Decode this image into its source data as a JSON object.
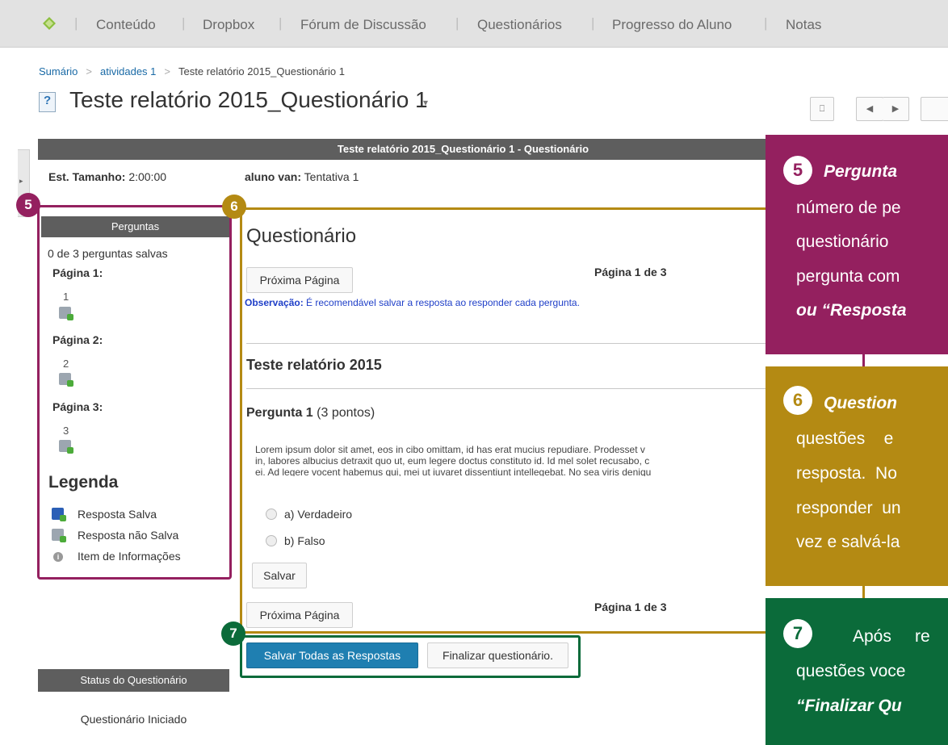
{
  "nav": {
    "logo_icon": "d2l-logo-icon",
    "items": [
      "Conteúdo",
      "Dropbox",
      "Fórum de Discussão",
      "Questionários",
      "Progresso do Aluno",
      "Notas"
    ],
    "separator": "|"
  },
  "breadcrumb": {
    "items": [
      "Sumário",
      "atividades 1"
    ],
    "current": "Teste relatório 2015_Questionário 1",
    "separator": ">"
  },
  "page": {
    "title": "Teste relatório 2015_Questionário 1",
    "title_icon": "?",
    "caret": "▾",
    "bookmark_icon": "⎕",
    "prev_icon": "◀",
    "next_icon": "▶"
  },
  "quiz": {
    "header": "Teste relatório 2015_Questionário 1 - Questionário",
    "est_label": "Est. Tamanho:",
    "est_value": "2:00:00",
    "attempt_label": "aluno van:",
    "attempt_value": "Tentativa 1",
    "title": "Questionário",
    "next_page": "Próxima Página",
    "page_of": "Página 1 de 3",
    "note_label": "Observação:",
    "note_text": "É recomendável salvar a resposta ao responder cada pergunta.",
    "section_title": "Teste relatório 2015",
    "question_label": "Pergunta 1",
    "question_points": "(3 pontos)",
    "question_lines": [
      "Lorem ipsum dolor sit amet, eos in cibo omittam, id has erat mucius repudiare. Prodesset v",
      "in, labores albucius detraxit quo ut, eum legere doctus constituto id. Id mel solet recusabo, c",
      "ei. Ad legere vocent habemus qui, mei ut iuvaret dissentiunt intellegebat. No sea viris deniqu"
    ],
    "options": [
      "a) Verdadeiro",
      "b) Falso"
    ],
    "save": "Salvar",
    "save_all": "Salvar Todas as Respostas",
    "finish": "Finalizar questionário."
  },
  "left_panel": {
    "header": "Perguntas",
    "saved_count": "0 de 3 perguntas salvas",
    "pages": [
      {
        "label": "Página 1:",
        "question": "1"
      },
      {
        "label": "Página 2:",
        "question": "2"
      },
      {
        "label": "Página 3:",
        "question": "3"
      }
    ],
    "legend_title": "Legenda",
    "legend": [
      {
        "icon": "saved-answer-icon",
        "label": "Resposta Salva"
      },
      {
        "icon": "unsaved-answer-icon",
        "label": "Resposta não Salva"
      },
      {
        "icon": "info-item-icon",
        "label": "Item de Informações"
      }
    ]
  },
  "status": {
    "header": "Status do Questionário",
    "value": "Questionário Iniciado"
  },
  "badges": {
    "five": "5",
    "six": "6",
    "seven": "7"
  },
  "callouts": {
    "c5": {
      "num": "5",
      "title": "Pergunta",
      "lines": [
        "número de pe",
        "questionário",
        "pergunta com",
        "ou “Resposta"
      ]
    },
    "c6": {
      "num": "6",
      "title": "Question",
      "lines": [
        "questões    e",
        "resposta.  No",
        "responder  un",
        "vez e salvá-la"
      ]
    },
    "c7": {
      "num": "7",
      "title": "",
      "lines": [
        "Após     re",
        "questões voce",
        "“Finalizar Qu"
      ]
    }
  },
  "colors": {
    "annotation_5": "#94205f",
    "annotation_6": "#b48a13",
    "annotation_7": "#0b6b3a",
    "primary_button": "#1f7fb1"
  }
}
